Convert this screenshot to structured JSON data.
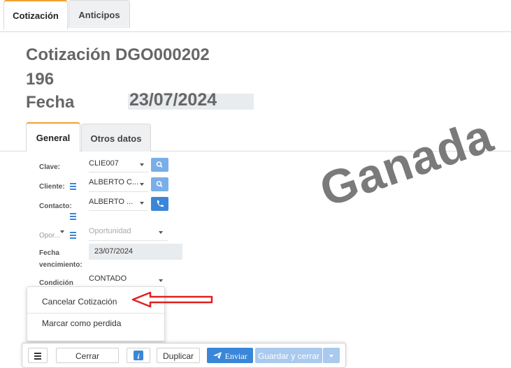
{
  "tabs_top": {
    "quote": "Cotización",
    "advances": "Anticipos"
  },
  "header": {
    "title": "Cotización DGO000202",
    "number": "196",
    "date_label": "Fecha",
    "date_value": "23/07/2024"
  },
  "tabs_inner": {
    "general": "General",
    "other": "Otros datos"
  },
  "form": {
    "clave_label": "Clave:",
    "clave_value": "CLIE007",
    "cliente_label": "Cliente:",
    "cliente_value": "ALBERTO C...",
    "contacto_label": "Contacto:",
    "contacto_value": "ALBERTO ...",
    "oportunidad_label": "Opor...",
    "oportunidad_placeholder": "Oportunidad",
    "vencimiento_label_1": "Fecha",
    "vencimiento_label_2": "vencimiento:",
    "vencimiento_value": "23/07/2024",
    "condicion_label": "Condición",
    "condicion_value": "CONTADO"
  },
  "watermark": "Ganada",
  "menu": {
    "cancel": "Cancelar Cotización",
    "mark_lost": "Marcar como perdida"
  },
  "toolbar": {
    "close": "Cerrar",
    "duplicate": "Duplicar",
    "send": "Enviar",
    "save_close": "Guardar y cerrar"
  },
  "colors": {
    "accent_tab": "#f0a030",
    "primary_button": "#3a86d8",
    "light_button": "#7aaee8",
    "arrow": "#e02020"
  }
}
